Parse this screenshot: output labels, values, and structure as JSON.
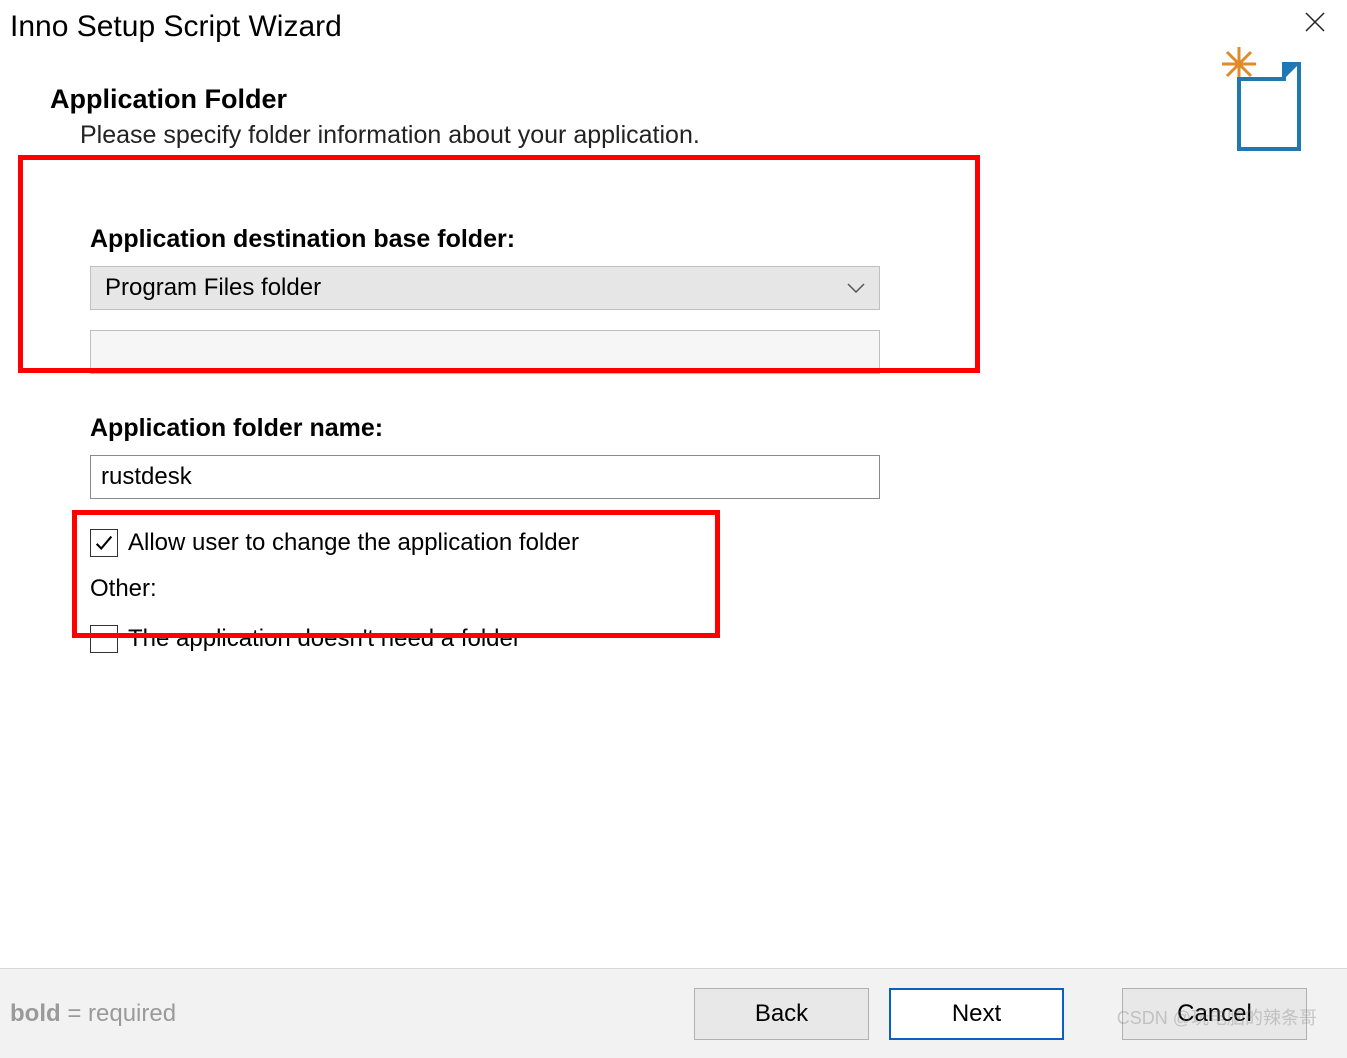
{
  "window": {
    "title": "Inno Setup Script Wizard"
  },
  "header": {
    "title": "Application Folder",
    "subtitle": "Please specify folder information about your application."
  },
  "form": {
    "destination_label": "Application destination base folder:",
    "destination_value": "Program Files folder",
    "custom_path_value": "",
    "folder_name_label": "Application folder name:",
    "folder_name_value": "rustdesk",
    "allow_change_label": "Allow user to change the application folder",
    "allow_change_checked": true,
    "other_label": "Other:",
    "no_folder_label": "The application doesn't need a folder",
    "no_folder_checked": false
  },
  "footer": {
    "hint_bold": "bold",
    "hint_rest": " = required",
    "back": "Back",
    "next": "Next",
    "cancel": "Cancel"
  },
  "watermark": "CSDN @玩电脑的辣条哥"
}
